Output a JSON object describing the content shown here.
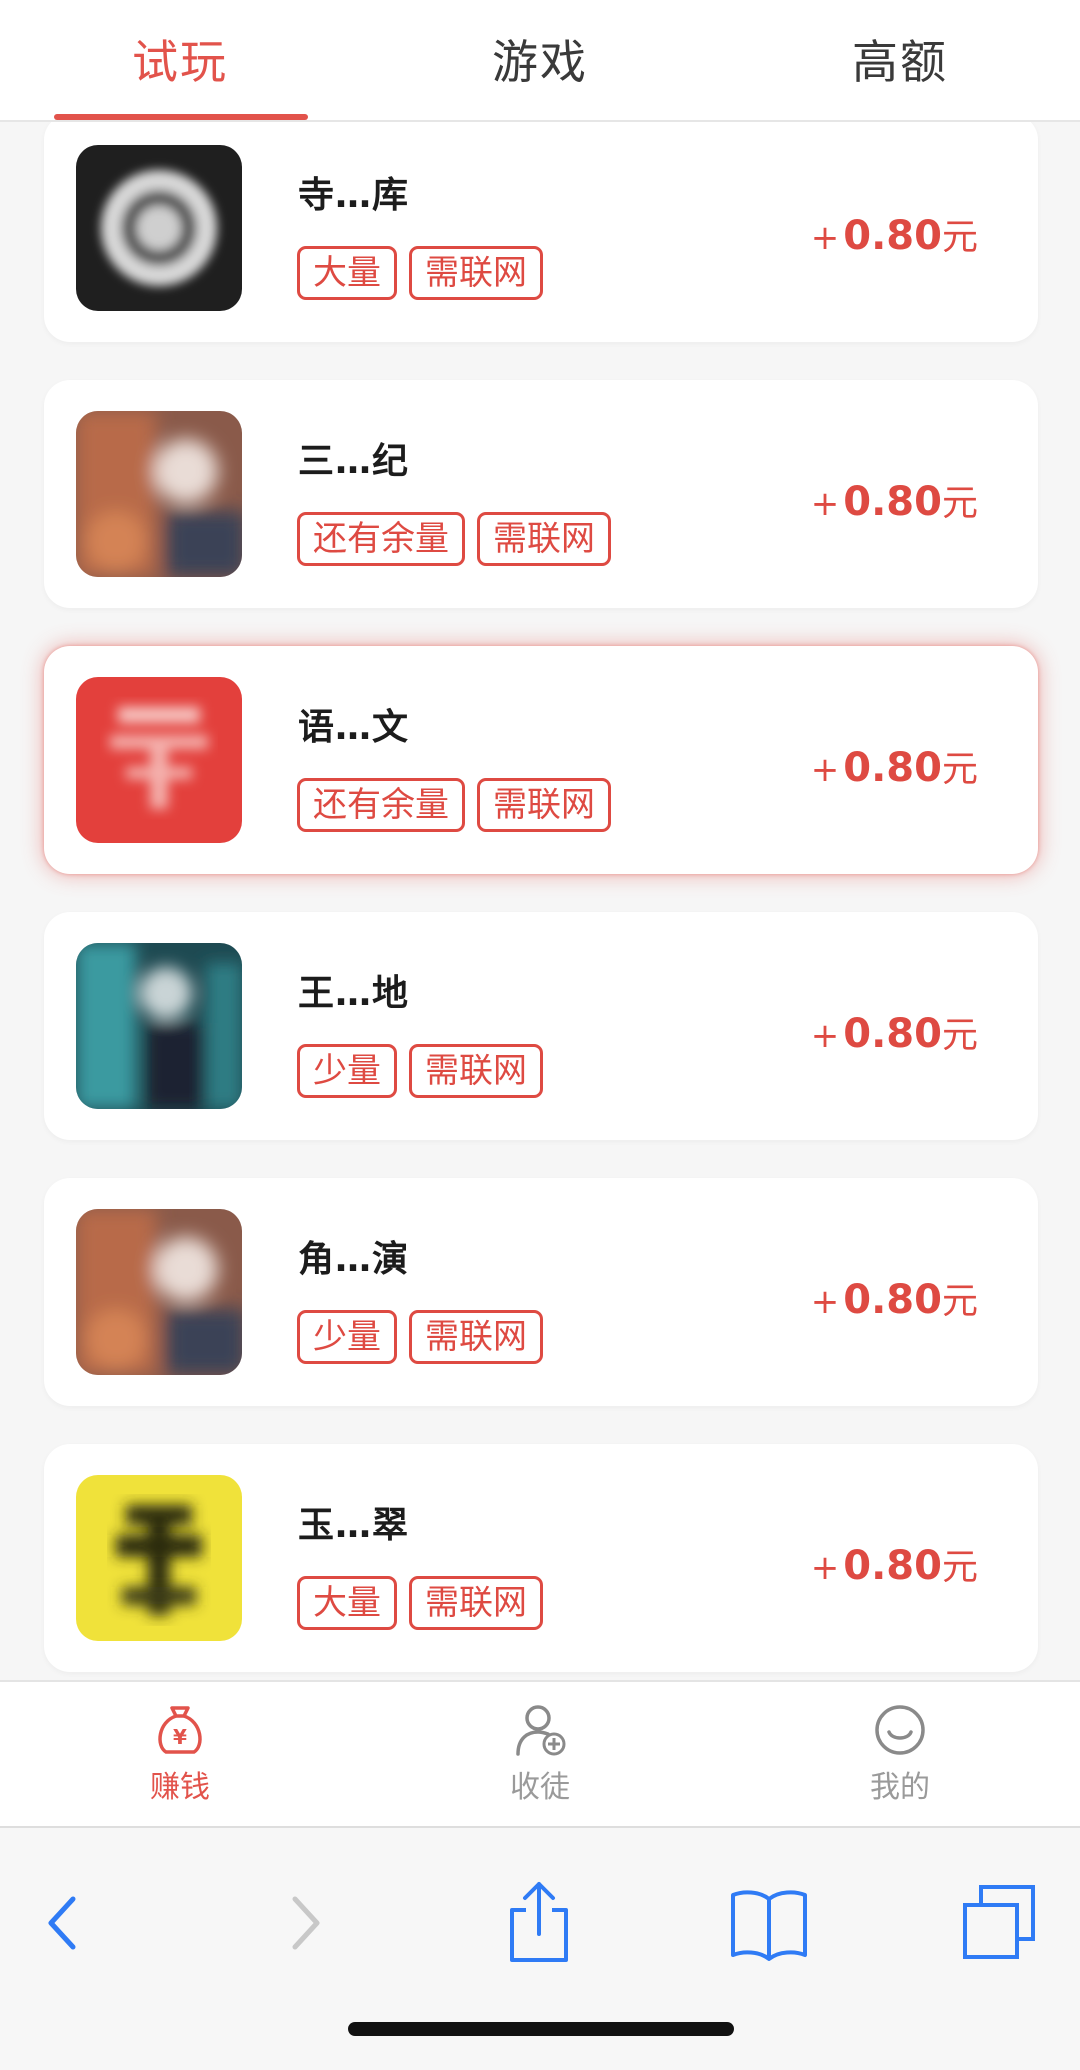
{
  "tabs": [
    {
      "label": "试玩",
      "active": true
    },
    {
      "label": "游戏",
      "active": false
    },
    {
      "label": "高额",
      "active": false
    }
  ],
  "apps": [
    {
      "name": "寺…库",
      "tags": [
        "大量",
        "需联网"
      ],
      "reward_prefix": "+",
      "reward_amount": "0.80",
      "reward_unit": "元",
      "icon": "circle-logo-icon",
      "highlighted": false
    },
    {
      "name": "三…纪",
      "tags": [
        "还有余量",
        "需联网"
      ],
      "reward_prefix": "+",
      "reward_amount": "0.80",
      "reward_unit": "元",
      "icon": "game-character-icon",
      "highlighted": false
    },
    {
      "name": "语…文",
      "tags": [
        "还有余量",
        "需联网"
      ],
      "reward_prefix": "+",
      "reward_amount": "0.80",
      "reward_unit": "元",
      "icon": "red-logo-icon",
      "highlighted": true
    },
    {
      "name": "王…地",
      "tags": [
        "少量",
        "需联网"
      ],
      "reward_prefix": "+",
      "reward_amount": "0.80",
      "reward_unit": "元",
      "icon": "teal-character-icon",
      "highlighted": false
    },
    {
      "name": "角…演",
      "tags": [
        "少量",
        "需联网"
      ],
      "reward_prefix": "+",
      "reward_amount": "0.80",
      "reward_unit": "元",
      "icon": "game-character-icon",
      "highlighted": false
    },
    {
      "name": "玉…翠",
      "tags": [
        "大量",
        "需联网"
      ],
      "reward_prefix": "+",
      "reward_amount": "0.80",
      "reward_unit": "元",
      "icon": "yellow-logo-icon",
      "highlighted": false
    }
  ],
  "bottom_nav": [
    {
      "label": "赚钱",
      "icon": "money-bag-icon",
      "active": true
    },
    {
      "label": "收徒",
      "icon": "add-user-icon",
      "active": false
    },
    {
      "label": "我的",
      "icon": "smiley-icon",
      "active": false
    }
  ],
  "browser_toolbar": {
    "icons": [
      "back-icon",
      "forward-icon",
      "share-icon",
      "bookmarks-icon",
      "tabs-icon"
    ]
  },
  "colors": {
    "accent": "#e2534b",
    "tag_border": "#de4a42",
    "browser_blue": "#2f7bf5",
    "inactive_gray": "#9a9a9a"
  }
}
